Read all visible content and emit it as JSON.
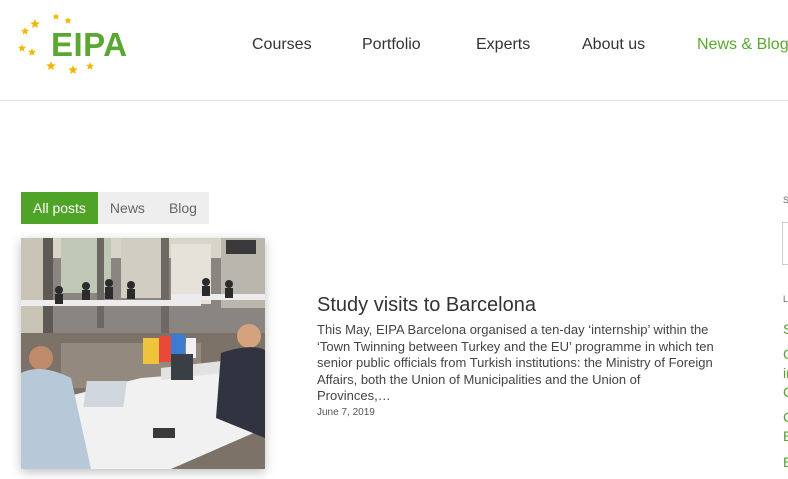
{
  "brand": {
    "logo_text": "EIPA",
    "logo_color": "#5aa832",
    "star_color": "#f2b705"
  },
  "nav": {
    "items": [
      {
        "label": "Courses"
      },
      {
        "label": "Portfolio"
      },
      {
        "label": "Experts"
      },
      {
        "label": "About us"
      },
      {
        "label": "News & Blog",
        "active": true
      }
    ]
  },
  "filters": {
    "items": [
      {
        "label": "All posts",
        "active": true
      },
      {
        "label": "News"
      },
      {
        "label": "Blog"
      }
    ],
    "active_color": "#4fa326"
  },
  "post": {
    "title": "Study visits to Barcelona",
    "excerpt": "This May, EIPA Barcelona organised a ten-day ‘internship’ within the ‘Town Twinning between Turkey and the EU’ programme in which ten senior public officials from Turkish institutions: the Ministry of Foreign Affairs, both the Union of Municipalities and the Union of Provinces,…",
    "date": "June 7, 2019"
  },
  "sidebar": {
    "search_label_fragment": "S",
    "latest_label_fragment": "L",
    "link_fragments": [
      "S",
      "C",
      "ir",
      "C",
      "C",
      "E",
      "E"
    ]
  }
}
